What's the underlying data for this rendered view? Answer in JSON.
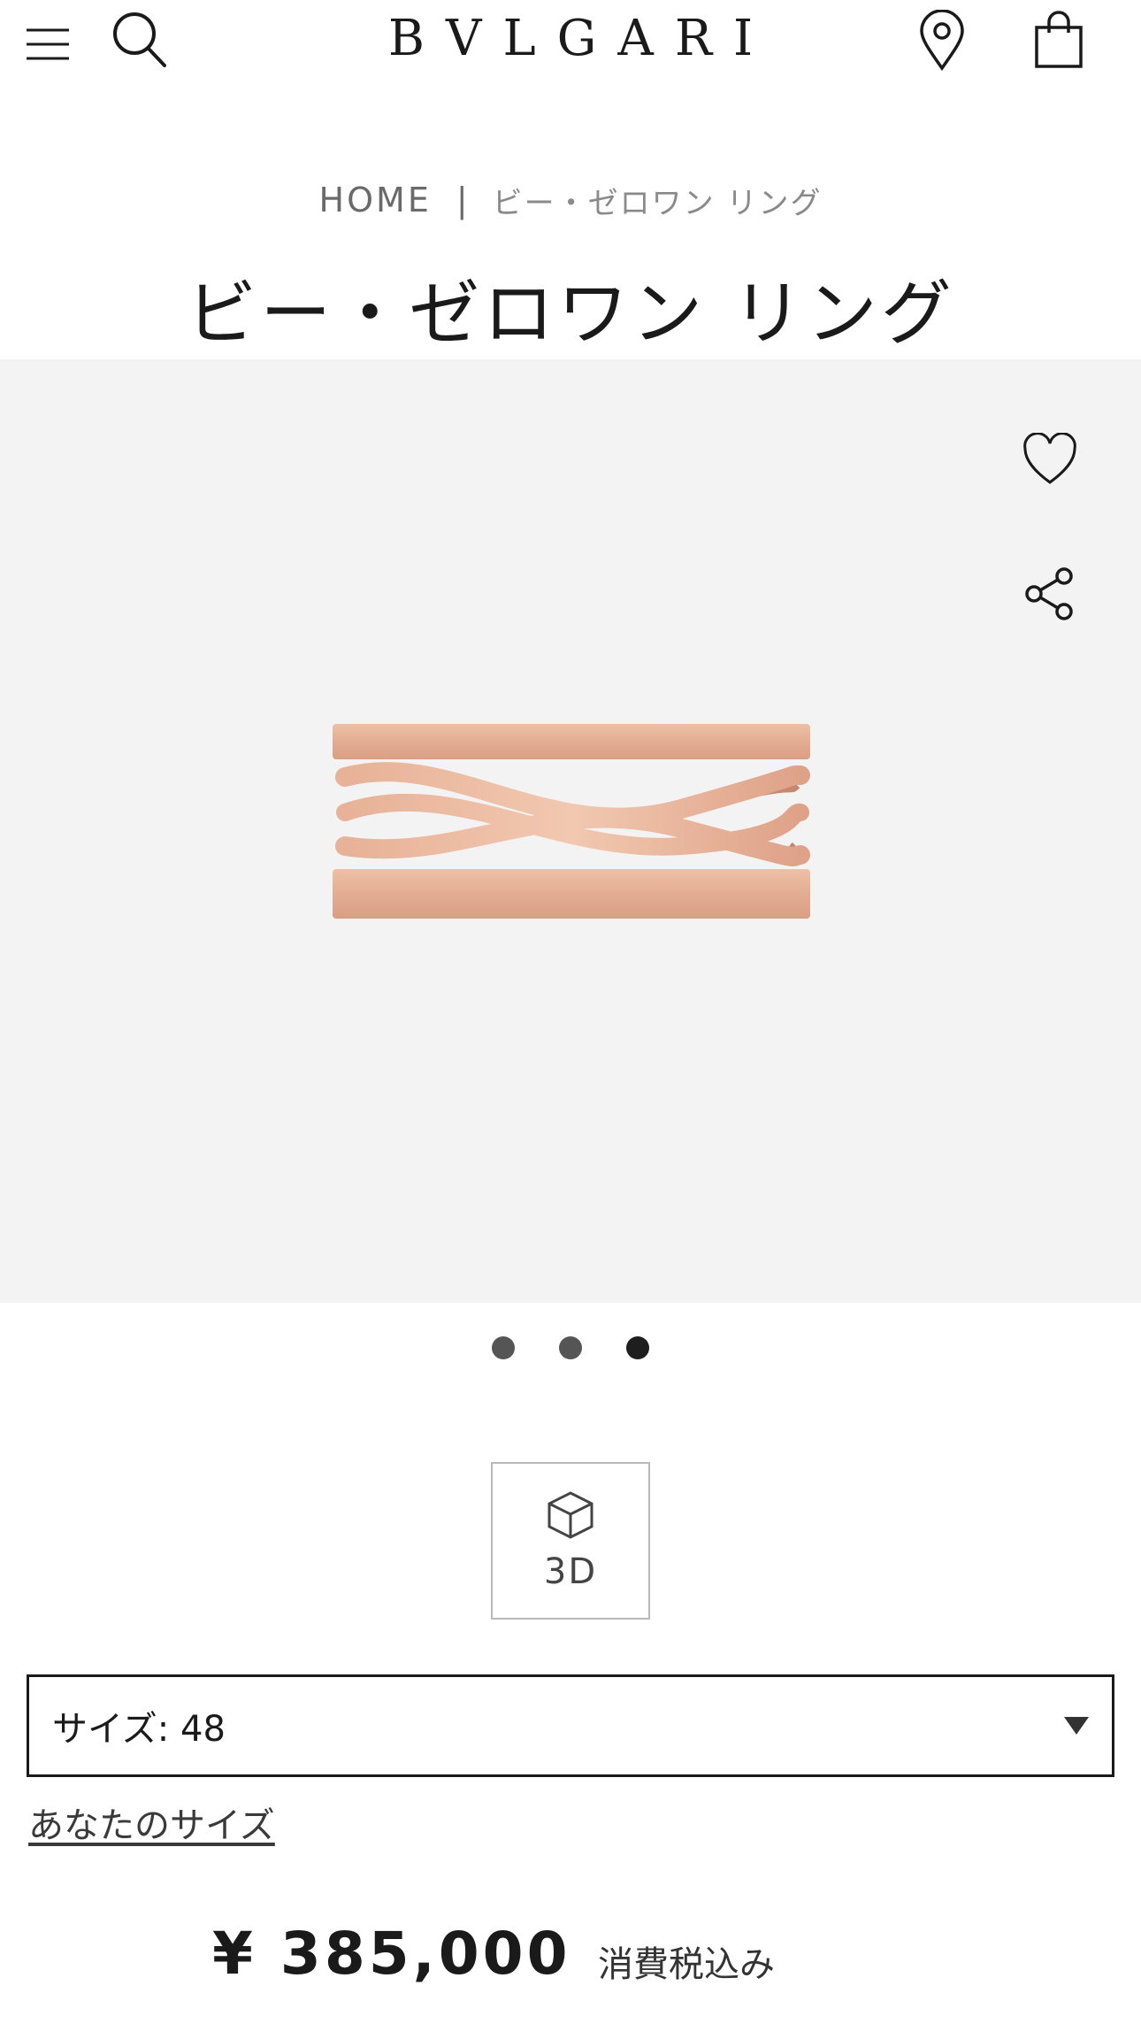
{
  "header": {
    "logo": "BVLGARI",
    "icons": {
      "menu": "hamburger-menu-icon",
      "search": "search-icon",
      "store_locator": "location-pin-icon",
      "bag": "shopping-bag-icon"
    }
  },
  "breadcrumb": {
    "home": "HOME",
    "separator": "|",
    "current": "ビー・ゼロワン リング"
  },
  "product": {
    "title": "ビー・ゼロワン リング",
    "image_alt": "rose gold ring",
    "gallery_bg": "#f4f3f3",
    "metal_color": "#e8b69b",
    "carousel": {
      "total": 3,
      "active_index": 3
    }
  },
  "actions": {
    "wishlist_icon": "heart-icon",
    "share_icon": "share-icon",
    "view_3d_label": "3D",
    "view_3d_icon": "cube-icon"
  },
  "size_selector": {
    "label": "サイズ: 48"
  },
  "size_guide_link": "あなたのサイズ",
  "price": {
    "amount": "¥ 385,000",
    "tax_note": "消費税込み"
  }
}
